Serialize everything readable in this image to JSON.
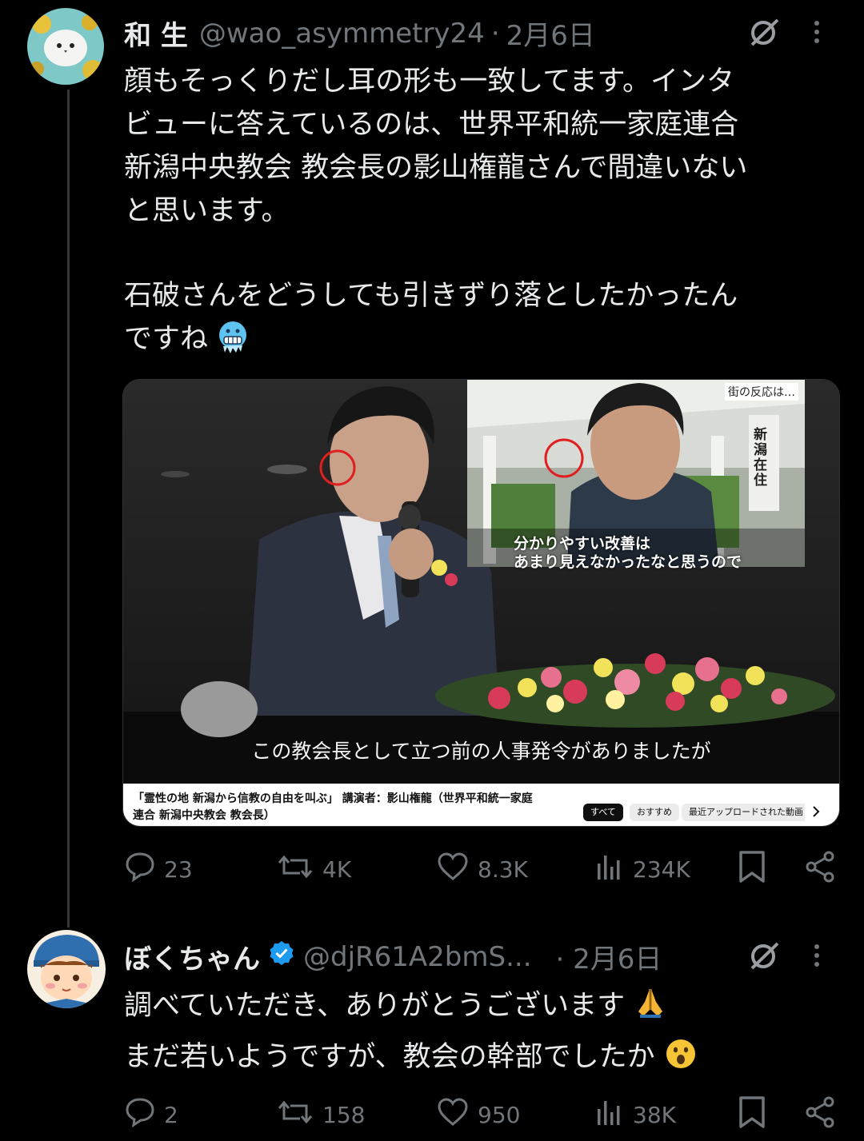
{
  "tweet1": {
    "name": "和 生",
    "handle": "@wao_asymmetry24",
    "date": "2月6日",
    "text_lines": [
      "顔もそっくりだし耳の形も一致してます。インタ",
      "ビューに答えているのは、世界平和統一家庭連合",
      "新潟中央教会 教会長の影山権龍さんで間違いない",
      "と思います。",
      "",
      "石破さんをどうしても引きずり落としたかったん",
      "ですね"
    ],
    "emoji": "freezing-face",
    "media": {
      "inset_overlay_text": "街の反応は…",
      "inset_sign": "新潟在住",
      "inset_caption_line1": "分かりやすい改善は",
      "inset_caption_line2": "あまり見えなかったなと思うので",
      "subtitle": "この教会長として立つ前の人事発令がありましたが",
      "video_title_line1": "「霊性の地 新潟から信教の自由を叫ぶ」 講演者：影山権龍（世界平和統一家庭",
      "video_title_line2": "連合 新潟中央教会 教会長）",
      "chips": [
        "すべて",
        "おすすめ",
        "最近アップロードされた動画"
      ]
    },
    "stats": {
      "replies": "23",
      "retweets": "4K",
      "likes": "8.3K",
      "views": "234K"
    }
  },
  "tweet2": {
    "name": "ぼくちゃん",
    "handle": "@djR61A2bmS...",
    "date": "· 2月6日",
    "text_line1": "調べていただき、ありがとうございます",
    "text_line2": "まだ若いようですが、教会の幹部でしたか",
    "stats": {
      "replies": "2",
      "retweets": "158",
      "likes": "950",
      "views": "38K"
    }
  },
  "colors": {
    "background": "#000000",
    "text": "#e7e9ea",
    "muted": "#71767b",
    "verified": "#1d9bf0"
  }
}
